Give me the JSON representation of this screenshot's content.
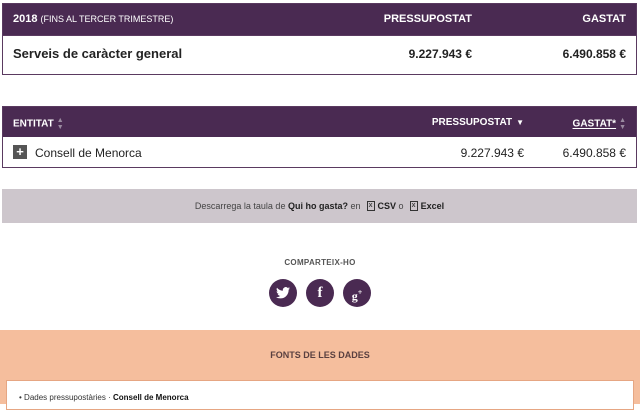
{
  "summary": {
    "year": "2018",
    "period": "(FINS AL TERCER TRIMESTRE)",
    "budget_header": "PRESSUPOSTAT",
    "spent_header": "GASTAT",
    "row_label": "Serveis de caràcter general",
    "row_budget": "9.227.943 €",
    "row_spent": "6.490.858 €"
  },
  "entities": {
    "col_entity": "ENTITAT",
    "col_budget": "PRESSUPOSTAT",
    "col_spent": "GASTAT*",
    "rows": [
      {
        "name": "Consell de Menorca",
        "budget": "9.227.943 €",
        "spent": "6.490.858 €"
      }
    ]
  },
  "download": {
    "prefix": "Descarrega la taula de",
    "dataset": "Qui ho gasta?",
    "in": "en",
    "csv": "CSV",
    "or": "o",
    "excel": "Excel"
  },
  "share": {
    "title": "COMPARTEIX-HO",
    "networks": [
      "twitter-icon",
      "facebook-icon",
      "google-plus-icon"
    ]
  },
  "sources": {
    "title": "FONTS DE LES DADES",
    "item_prefix": "Dades pressupostàries ·",
    "item_source": "Consell de Menorca"
  },
  "colors": {
    "primary": "#4a2a52",
    "download_bg": "#cdc6cc",
    "sources_bg": "#f5be9d"
  }
}
